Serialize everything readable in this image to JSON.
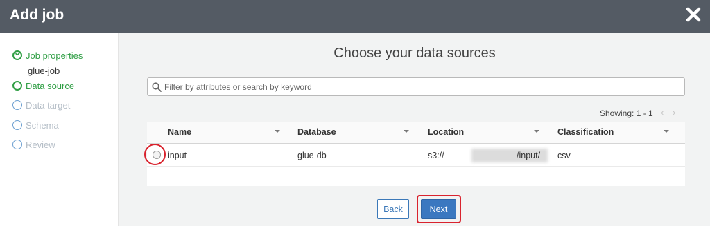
{
  "header": {
    "title": "Add job",
    "close_icon": "close-icon"
  },
  "sidebar": {
    "steps": [
      {
        "label": "Job properties",
        "state": "complete",
        "sub_label": "glue-job"
      },
      {
        "label": "Data source",
        "state": "current"
      },
      {
        "label": "Data target",
        "state": "pending"
      },
      {
        "label": "Schema",
        "state": "pending"
      },
      {
        "label": "Review",
        "state": "pending"
      }
    ]
  },
  "main": {
    "heading": "Choose your data sources",
    "search": {
      "placeholder": "Filter by attributes or search by keyword",
      "value": ""
    },
    "pagination": {
      "showing": "Showing: 1 - 1",
      "prev": "‹",
      "next": "›"
    },
    "table": {
      "columns": [
        "Name",
        "Database",
        "Location",
        "Classification"
      ],
      "rows": [
        {
          "name": "input",
          "database": "glue-db",
          "location_prefix": "s3://",
          "location_suffix": "/input/",
          "classification": "csv",
          "selected": false
        }
      ]
    }
  },
  "footer": {
    "back_label": "Back",
    "next_label": "Next"
  },
  "colors": {
    "header_bg": "#545b64",
    "active_step": "#2f9e44",
    "primary": "#3b78c0",
    "highlight": "#d9232e"
  }
}
